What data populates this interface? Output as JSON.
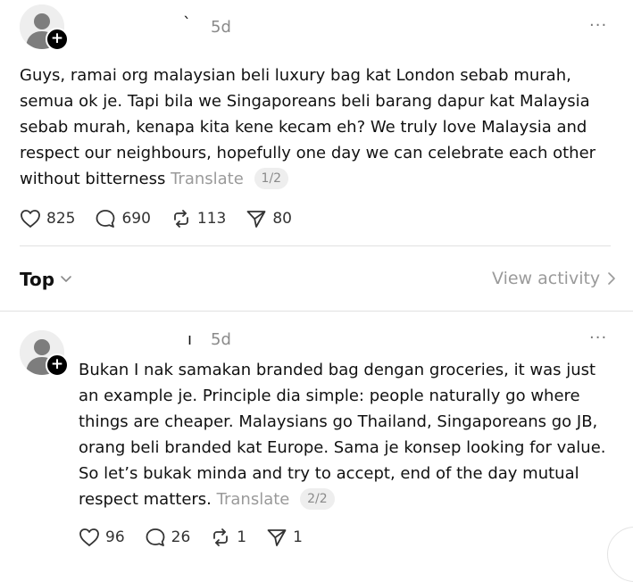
{
  "post1": {
    "username": "`",
    "time": "5d",
    "more": "···",
    "text": "Guys, ramai org malaysian beli luxury bag kat London sebab murah, semua ok je. Tapi bila we Singaporeans beli barang dapur kat Malaysia sebab murah, kenapa kita kene kecam eh? We truly love Malaysia and respect our neighbours, hopefully one day we can celebrate each other without bitterness",
    "translate": "Translate",
    "pager": "1/2",
    "likes": "825",
    "comments": "690",
    "reposts": "113",
    "shares": "80"
  },
  "sort": {
    "label": "Top",
    "view_activity": "View activity"
  },
  "post2": {
    "username": "ı",
    "time": "5d",
    "more": "···",
    "text": "Bukan I nak samakan branded bag dengan groceries, it was just an example je. Principle dia simple: people naturally go where things are cheaper. Malaysians go Thailand, Singaporeans go JB, orang beli branded kat Europe. Sama je konsep looking for value. So let’s bukak minda and try to accept, end of the day mutual respect matters.",
    "translate": "Translate",
    "pager": "2/2",
    "likes": "96",
    "comments": "26",
    "reposts": "1",
    "shares": "1"
  },
  "icons": {
    "like": "heart-icon",
    "comment": "comment-bubble-icon",
    "repost": "repost-icon",
    "share": "send-icon",
    "follow": "plus-icon",
    "chevron": "chevron-down-icon",
    "arrow": "chevron-right-icon"
  }
}
